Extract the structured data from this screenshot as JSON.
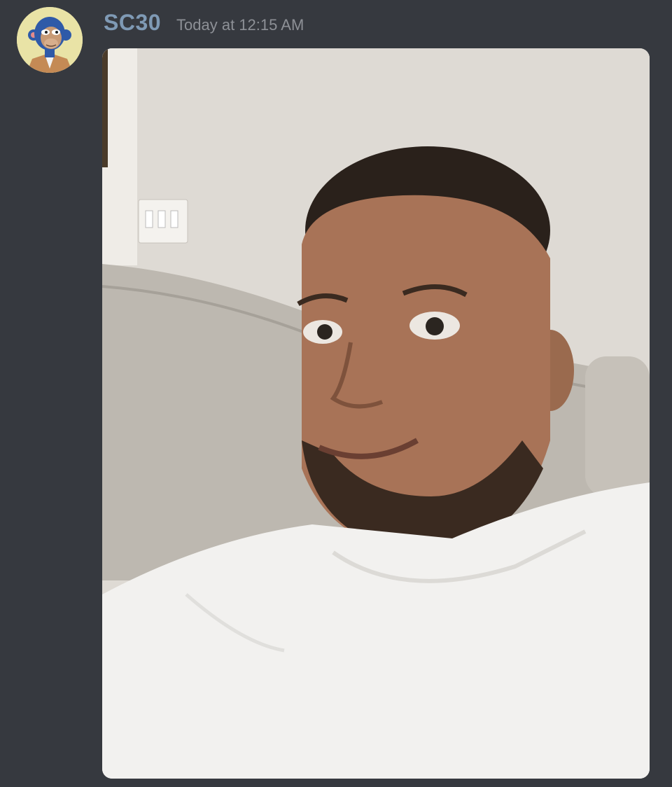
{
  "message": {
    "author": {
      "name": "SC30",
      "avatar_icon": "bored-ape-avatar-icon",
      "name_color": "#7f9ab5"
    },
    "timestamp": "Today at 12:15 AM",
    "attachment": {
      "type": "image",
      "icon": "selfie-photo-image"
    }
  },
  "theme": {
    "background": "#36393f",
    "avatar_background": "#e9e3a6"
  }
}
